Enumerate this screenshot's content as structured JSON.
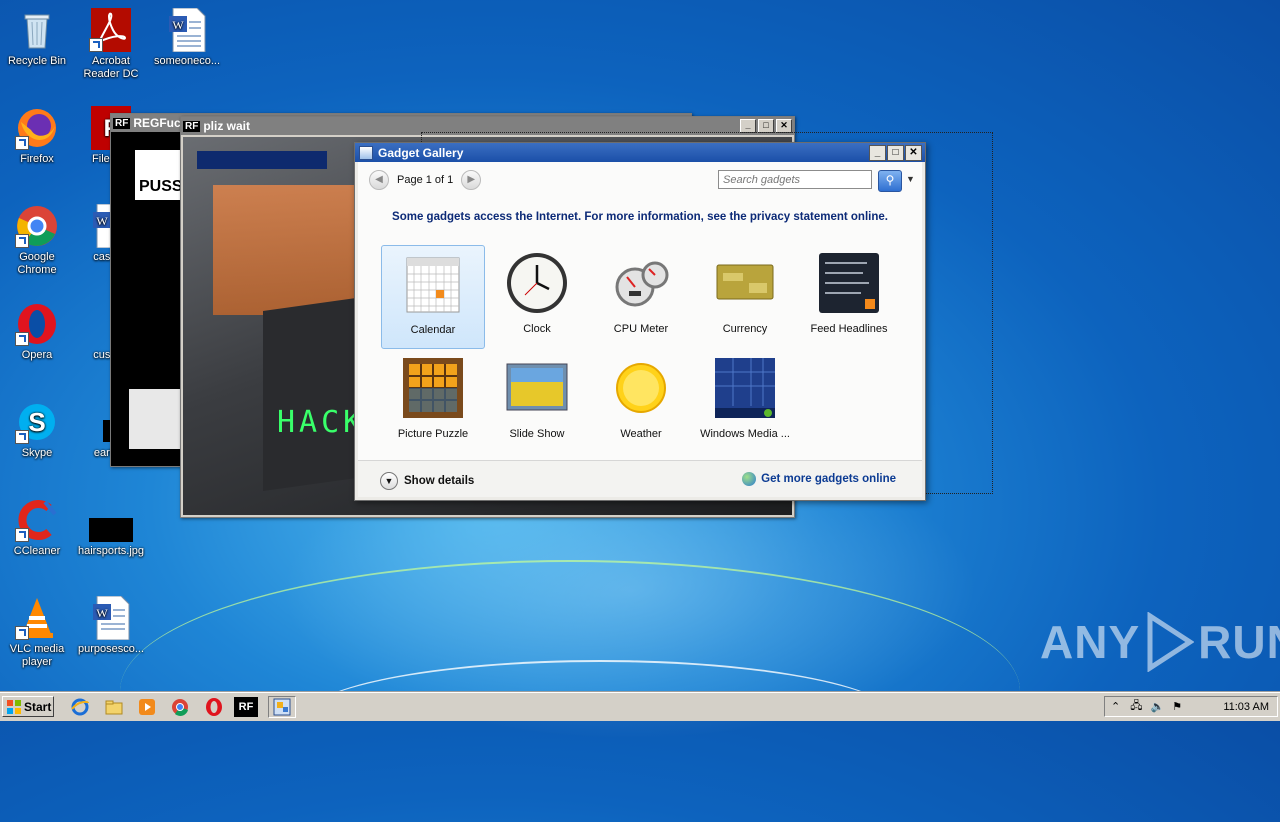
{
  "desktop_icons": [
    {
      "label": "Recycle Bin"
    },
    {
      "label": "Acrobat Reader DC"
    },
    {
      "label": "someoneco..."
    },
    {
      "label": "Firefox"
    },
    {
      "label": "FileZilla"
    },
    {
      "label": "Google Chrome"
    },
    {
      "label": "caseab"
    },
    {
      "label": "Opera"
    },
    {
      "label": "custom"
    },
    {
      "label": "Skype"
    },
    {
      "label": "earthm"
    },
    {
      "label": "CCleaner"
    },
    {
      "label": "hairsports.jpg"
    },
    {
      "label": "VLC media player"
    },
    {
      "label": "purposesco..."
    }
  ],
  "windows": {
    "back1_title": "REGFuck",
    "back1_text": "PUSS",
    "back2_title": "pliz wait",
    "back2_overlay": "HACK"
  },
  "gadget_gallery": {
    "title": "Gadget Gallery",
    "page_label": "Page 1 of 1",
    "search_placeholder": "Search gadgets",
    "notice": "Some gadgets access the Internet.  For more information, see the privacy statement online.",
    "gadgets": [
      {
        "label": "Calendar",
        "icon": "calendar-icon",
        "selected": true
      },
      {
        "label": "Clock",
        "icon": "clock-icon"
      },
      {
        "label": "CPU Meter",
        "icon": "cpu-meter-icon"
      },
      {
        "label": "Currency",
        "icon": "currency-icon"
      },
      {
        "label": "Feed Headlines",
        "icon": "feed-icon"
      },
      {
        "label": "Picture Puzzle",
        "icon": "puzzle-icon"
      },
      {
        "label": "Slide Show",
        "icon": "slideshow-icon"
      },
      {
        "label": "Weather",
        "icon": "weather-icon"
      },
      {
        "label": "Windows Media ...",
        "icon": "media-center-icon"
      }
    ],
    "show_details": "Show details",
    "more_online": "Get more gadgets online"
  },
  "taskbar": {
    "start_label": "Start",
    "clock": "11:03 AM"
  },
  "watermark": {
    "left": "ANY",
    "right": "RUN"
  }
}
